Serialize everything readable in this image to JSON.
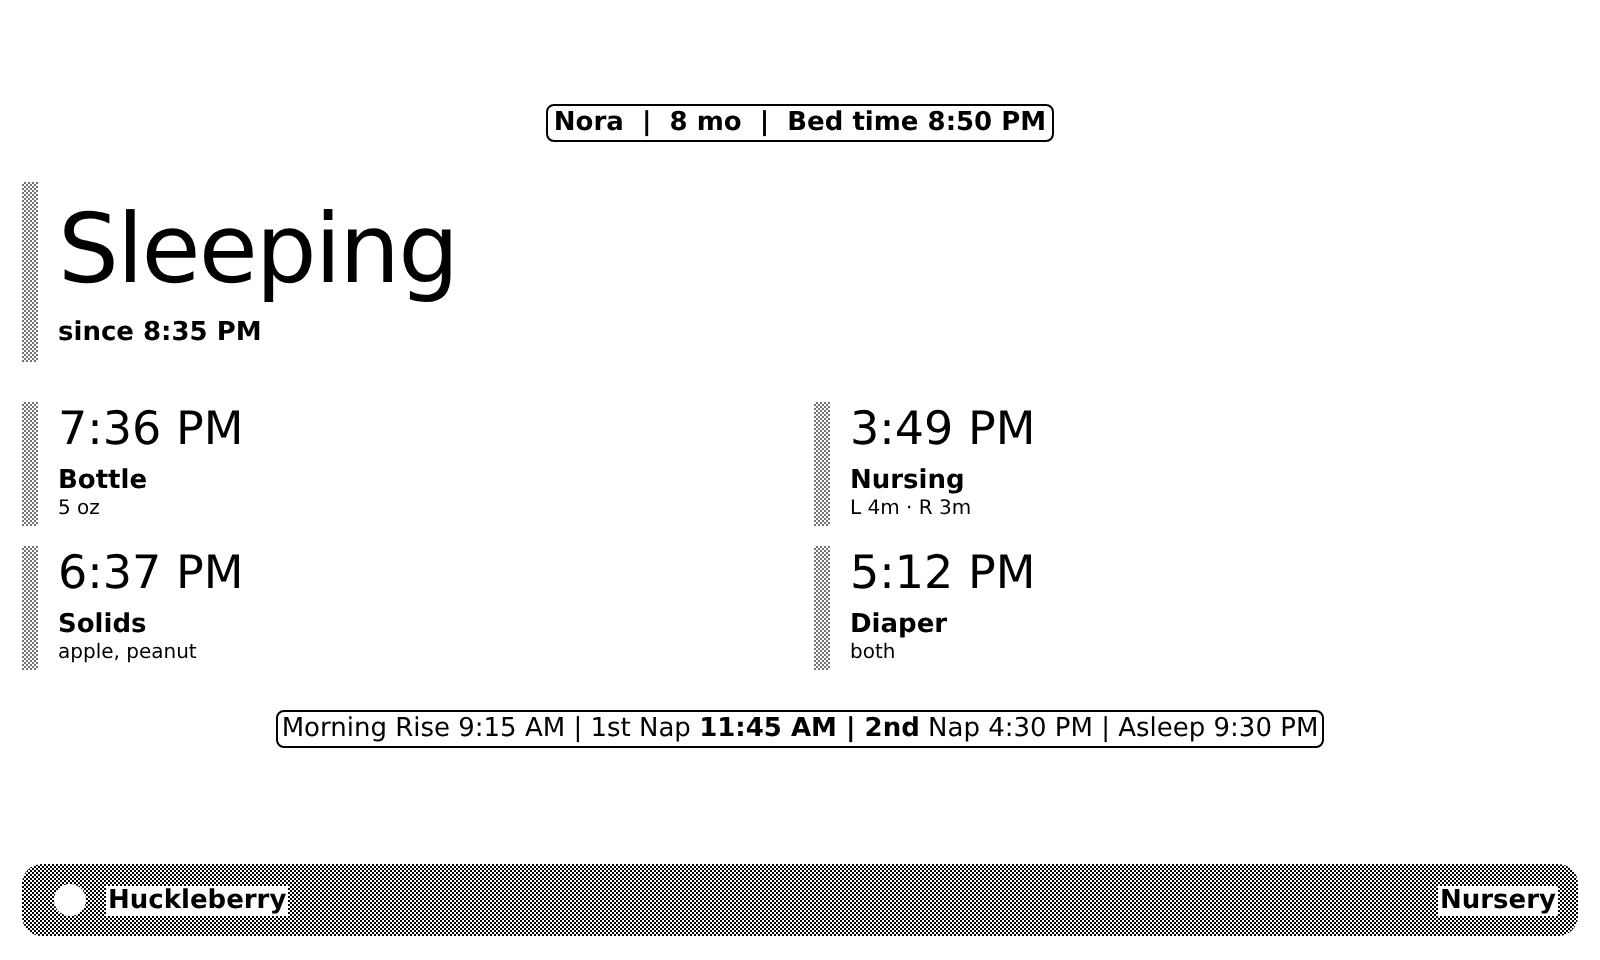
{
  "header": "Nora  |  8 mo  |  Bed time 8:50 PM",
  "status": {
    "state": "Sleeping",
    "since": "since 8:35 PM"
  },
  "events": [
    {
      "time": "7:36 PM",
      "label": "Bottle",
      "detail": "5 oz"
    },
    {
      "time": "3:49 PM",
      "label": "Nursing",
      "detail": "L 4m · R 3m"
    },
    {
      "time": "6:37 PM",
      "label": "Solids",
      "detail": "apple, peanut"
    },
    {
      "time": "5:12 PM",
      "label": "Diaper",
      "detail": "both"
    }
  ],
  "schedule": "Morning Rise 9:15 AM | 1st Nap **11:45 AM | 2nd** Nap 4:30 PM | Asleep 9:30 PM",
  "footer": {
    "left": "Huckleberry",
    "right": "Nursery"
  }
}
